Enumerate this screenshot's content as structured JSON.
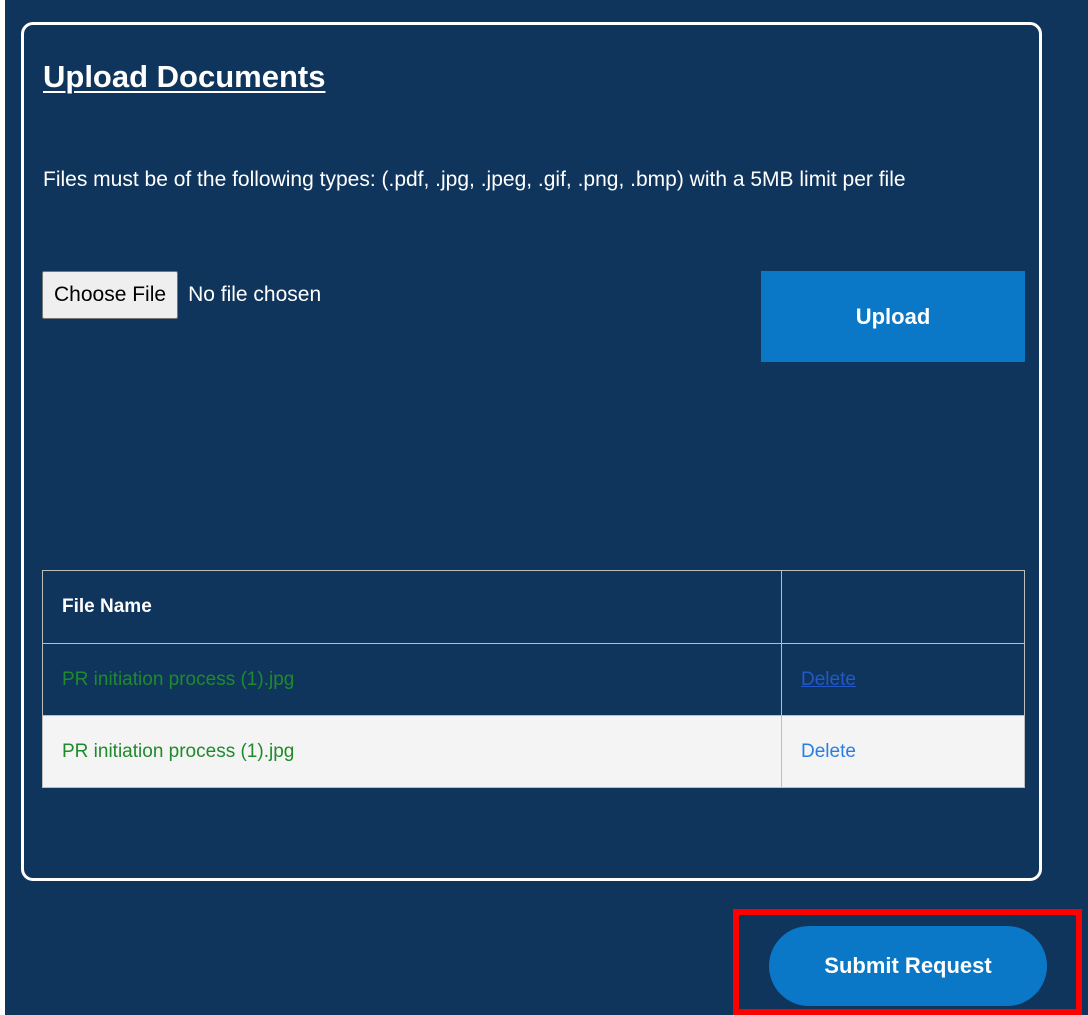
{
  "upload_section": {
    "title": "Upload Documents",
    "description": "Files must be of the following types: (.pdf, .jpg, .jpeg, .gif, .png, .bmp) with a 5MB limit per file",
    "choose_file_label": "Choose File",
    "file_status": "No file chosen",
    "upload_label": "Upload"
  },
  "files_table": {
    "columns": [
      "File Name",
      ""
    ],
    "rows": [
      {
        "file_name": "PR initiation process (1).jpg",
        "action": "Delete"
      },
      {
        "file_name": "PR initiation process (1).jpg",
        "action": "Delete"
      }
    ]
  },
  "submit_label": "Submit Request",
  "colors": {
    "background": "#10355c",
    "accent": "#0a78c6",
    "file_name": "#1f8a2c",
    "link": "#2a7de1",
    "highlight": "#ff0000"
  }
}
